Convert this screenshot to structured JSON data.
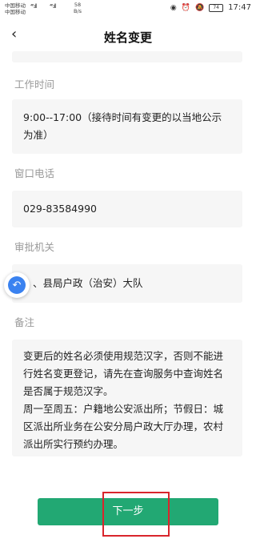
{
  "status_bar": {
    "carrier_1": "中国移动",
    "carrier_2": "中国移动",
    "signal_1": "⁴⁶.ıll",
    "signal_2": "⁴⁶.ıll",
    "net_speed": "58",
    "net_unit": "B/s",
    "battery": "74",
    "time": "17:47"
  },
  "header": {
    "back_icon": "‹",
    "title": "姓名变更"
  },
  "sections": {
    "hours": {
      "label": "工作时间",
      "value": "9:00--17:00（接待时间有变更的以当地公示为准）"
    },
    "phone": {
      "label": "窗口电话",
      "value": "029-83584990"
    },
    "authority": {
      "label": "审批机关",
      "value": "、县局户政（治安）大队"
    },
    "notes": {
      "label": "备注",
      "value": "变更后的姓名必须使用规范汉字，否则不能进行姓名变更登记，请先在查询服务中查询姓名是否属于规范汉字。\n周一至周五：户籍地公安派出所；节假日：城区派出所业务在公安分局户政大厅办理，农村派出所实行预约办理。"
    }
  },
  "float_button": {
    "icon": "undo-arrow-icon"
  },
  "footer": {
    "next_label": "下一步"
  }
}
